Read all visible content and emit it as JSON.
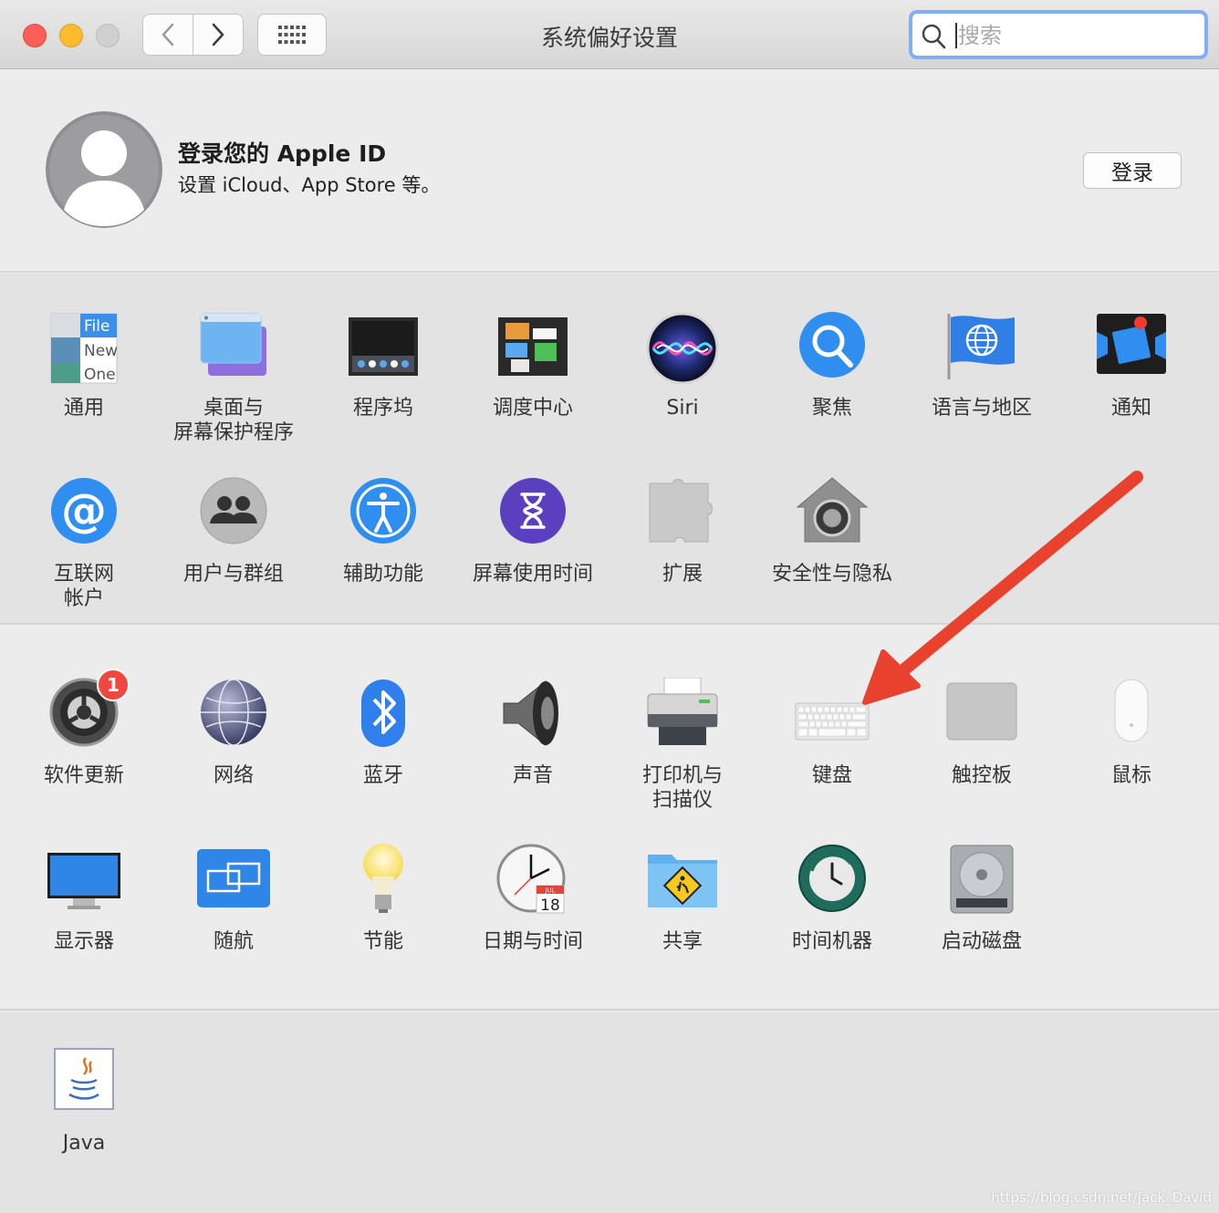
{
  "window": {
    "title": "系统偏好设置"
  },
  "search": {
    "placeholder": "搜索"
  },
  "account": {
    "title": "登录您的 Apple ID",
    "subtitle": "设置 iCloud、App Store 等。",
    "login_label": "登录"
  },
  "row1": [
    {
      "label": "通用",
      "icon": "general-icon"
    },
    {
      "label": "桌面与\n屏幕保护程序",
      "icon": "desktop-icon"
    },
    {
      "label": "程序坞",
      "icon": "dock-icon"
    },
    {
      "label": "调度中心",
      "icon": "mission-control-icon"
    },
    {
      "label": "Siri",
      "icon": "siri-icon"
    },
    {
      "label": "聚焦",
      "icon": "spotlight-icon"
    },
    {
      "label": "语言与地区",
      "icon": "language-icon"
    },
    {
      "label": "通知",
      "icon": "notifications-icon"
    }
  ],
  "general_icon_text": {
    "file": "File",
    "new": "New",
    "one": "One"
  },
  "row2": [
    {
      "label": "互联网\n帐户",
      "icon": "internet-accounts-icon"
    },
    {
      "label": "用户与群组",
      "icon": "users-icon"
    },
    {
      "label": "辅助功能",
      "icon": "accessibility-icon"
    },
    {
      "label": "屏幕使用时间",
      "icon": "screen-time-icon"
    },
    {
      "label": "扩展",
      "icon": "extensions-icon"
    },
    {
      "label": "安全性与隐私",
      "icon": "security-icon"
    }
  ],
  "row3": [
    {
      "label": "软件更新",
      "icon": "software-update-icon",
      "badge": "1"
    },
    {
      "label": "网络",
      "icon": "network-icon"
    },
    {
      "label": "蓝牙",
      "icon": "bluetooth-icon"
    },
    {
      "label": "声音",
      "icon": "sound-icon"
    },
    {
      "label": "打印机与\n扫描仪",
      "icon": "printer-icon"
    },
    {
      "label": "键盘",
      "icon": "keyboard-icon"
    },
    {
      "label": "触控板",
      "icon": "trackpad-icon"
    },
    {
      "label": "鼠标",
      "icon": "mouse-icon"
    }
  ],
  "row4": [
    {
      "label": "显示器",
      "icon": "display-icon"
    },
    {
      "label": "随航",
      "icon": "sidecar-icon"
    },
    {
      "label": "节能",
      "icon": "energy-icon"
    },
    {
      "label": "日期与时间",
      "icon": "date-time-icon"
    },
    {
      "label": "共享",
      "icon": "sharing-icon"
    },
    {
      "label": "时间机器",
      "icon": "time-machine-icon"
    },
    {
      "label": "启动磁盘",
      "icon": "startup-disk-icon"
    }
  ],
  "calendar_icon_text": {
    "month": "JUL",
    "day": "18"
  },
  "row5": [
    {
      "label": "Java",
      "icon": "java-icon"
    }
  ],
  "watermark": "https://blog.csdn.net/Jack_David",
  "colors": {
    "accent": "#3f8ef0",
    "arrow": "#e8422f",
    "badge": "#f0483e"
  }
}
